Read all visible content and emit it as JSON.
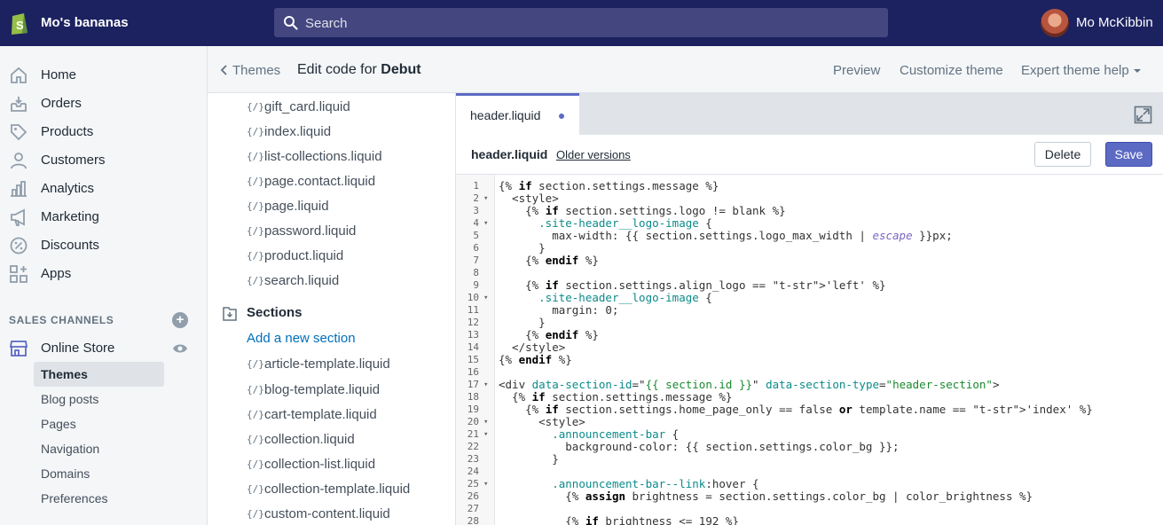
{
  "topbar": {
    "store_name": "Mo's bananas",
    "search_placeholder": "Search",
    "user_name": "Mo McKibbin",
    "brand_color": "#1c2260"
  },
  "sidebar": {
    "items": [
      {
        "label": "Home",
        "icon": "home-icon"
      },
      {
        "label": "Orders",
        "icon": "orders-icon"
      },
      {
        "label": "Products",
        "icon": "tag-icon"
      },
      {
        "label": "Customers",
        "icon": "person-icon"
      },
      {
        "label": "Analytics",
        "icon": "bar-chart-icon"
      },
      {
        "label": "Marketing",
        "icon": "megaphone-icon"
      },
      {
        "label": "Discounts",
        "icon": "discount-icon"
      },
      {
        "label": "Apps",
        "icon": "apps-icon"
      }
    ],
    "channels_title": "SALES CHANNELS",
    "online_store": "Online Store",
    "online_store_items": [
      "Themes",
      "Blog posts",
      "Pages",
      "Navigation",
      "Domains",
      "Preferences"
    ],
    "active_item": "Themes"
  },
  "page_header": {
    "back_label": "Themes",
    "title_prefix": "Edit code for",
    "title_theme": "Debut",
    "actions": [
      "Preview",
      "Customize theme",
      "Expert theme help"
    ]
  },
  "files": {
    "templates": [
      "gift_card.liquid",
      "index.liquid",
      "list-collections.liquid",
      "page.contact.liquid",
      "page.liquid",
      "password.liquid",
      "product.liquid",
      "search.liquid"
    ],
    "sections_title": "Sections",
    "add_section": "Add a new section",
    "sections": [
      "article-template.liquid",
      "blog-template.liquid",
      "cart-template.liquid",
      "collection.liquid",
      "collection-list.liquid",
      "collection-template.liquid",
      "custom-content.liquid"
    ],
    "file_icon": "{/}"
  },
  "editor": {
    "tab_label": "header.liquid",
    "file_name": "header.liquid",
    "older_versions": "Older versions",
    "delete_label": "Delete",
    "save_label": "Save",
    "accent_color": "#5c6ac4",
    "folded_lines": [
      2,
      4,
      10,
      17,
      20,
      21,
      25
    ],
    "lines": [
      "{% if section.settings.message %}",
      "  <style>",
      "    {% if section.settings.logo != blank %}",
      "      .site-header__logo-image {",
      "        max-width: {{ section.settings.logo_max_width | escape }}px;",
      "      }",
      "    {% endif %}",
      "",
      "    {% if section.settings.align_logo == 'left' %}",
      "      .site-header__logo-image {",
      "        margin: 0;",
      "      }",
      "    {% endif %}",
      "  </style>",
      "{% endif %}",
      "",
      "<div data-section-id=\"{{ section.id }}\" data-section-type=\"header-section\">",
      "  {% if section.settings.message %}",
      "    {% if section.settings.home_page_only == false or template.name == 'index' %}",
      "      <style>",
      "        .announcement-bar {",
      "          background-color: {{ section.settings.color_bg }};",
      "        }",
      "",
      "        .announcement-bar--link:hover {",
      "          {% assign brightness = section.settings.color_bg | color_brightness %}",
      "",
      "          {% if brightness <= 192 %}"
    ]
  }
}
